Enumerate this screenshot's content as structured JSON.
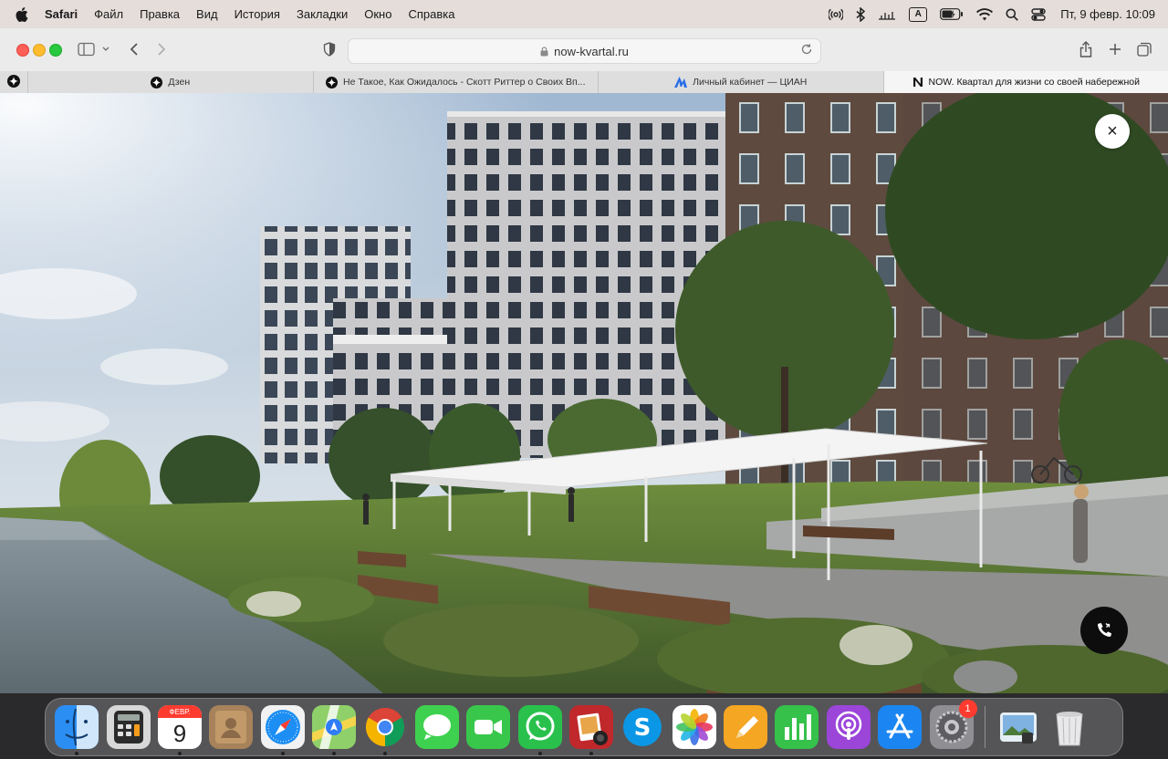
{
  "menubar": {
    "app": "Safari",
    "items": [
      "Файл",
      "Правка",
      "Вид",
      "История",
      "Закладки",
      "Окно",
      "Справка"
    ],
    "clock": "Пт, 9 февр.  10:09",
    "keyboard_layout": "A"
  },
  "toolbar": {
    "url": "now-kvartal.ru"
  },
  "tabs": [
    {
      "label": "Дзен",
      "icon": "dzen-icon"
    },
    {
      "label": "Не Такое, Как Ожидалось - Скотт Риттер о Своих Вп...",
      "icon": "dzen-icon"
    },
    {
      "label": "Личный кабинет — ЦИАН",
      "icon": "cian-icon"
    },
    {
      "label": "NOW. Квартал для жизни со своей набережной",
      "icon": "now-icon",
      "active": true
    }
  ],
  "page": {
    "close_symbol": "×",
    "accent_dark": "#0d0d0d"
  },
  "dock": {
    "apps": [
      {
        "name": "Finder",
        "icon": "finder-icon"
      },
      {
        "name": "Calculator",
        "icon": "calculator-icon"
      },
      {
        "name": "Calendar",
        "icon": "calendar-icon",
        "month": "ФЕВР.",
        "day": "9"
      },
      {
        "name": "Contacts",
        "icon": "contacts-icon"
      },
      {
        "name": "Safari",
        "icon": "safari-icon"
      },
      {
        "name": "Maps",
        "icon": "maps-icon"
      },
      {
        "name": "Chrome",
        "icon": "chrome-icon"
      },
      {
        "name": "Messages",
        "icon": "messages-icon"
      },
      {
        "name": "FaceTime",
        "icon": "facetime-icon"
      },
      {
        "name": "WhatsApp",
        "icon": "whatsapp-icon"
      },
      {
        "name": "Photo Booth",
        "icon": "photobooth-icon"
      },
      {
        "name": "Skype",
        "icon": "skype-icon"
      },
      {
        "name": "Photos",
        "icon": "photos-icon"
      },
      {
        "name": "Pages",
        "icon": "pages-icon"
      },
      {
        "name": "Numbers",
        "icon": "numbers-icon"
      },
      {
        "name": "Podcasts",
        "icon": "podcasts-icon"
      },
      {
        "name": "App Store",
        "icon": "appstore-icon"
      },
      {
        "name": "System Settings",
        "icon": "settings-icon",
        "badge": "1"
      },
      {
        "name": "Preview",
        "icon": "preview-icon"
      },
      {
        "name": "Trash",
        "icon": "trash-icon"
      }
    ]
  }
}
